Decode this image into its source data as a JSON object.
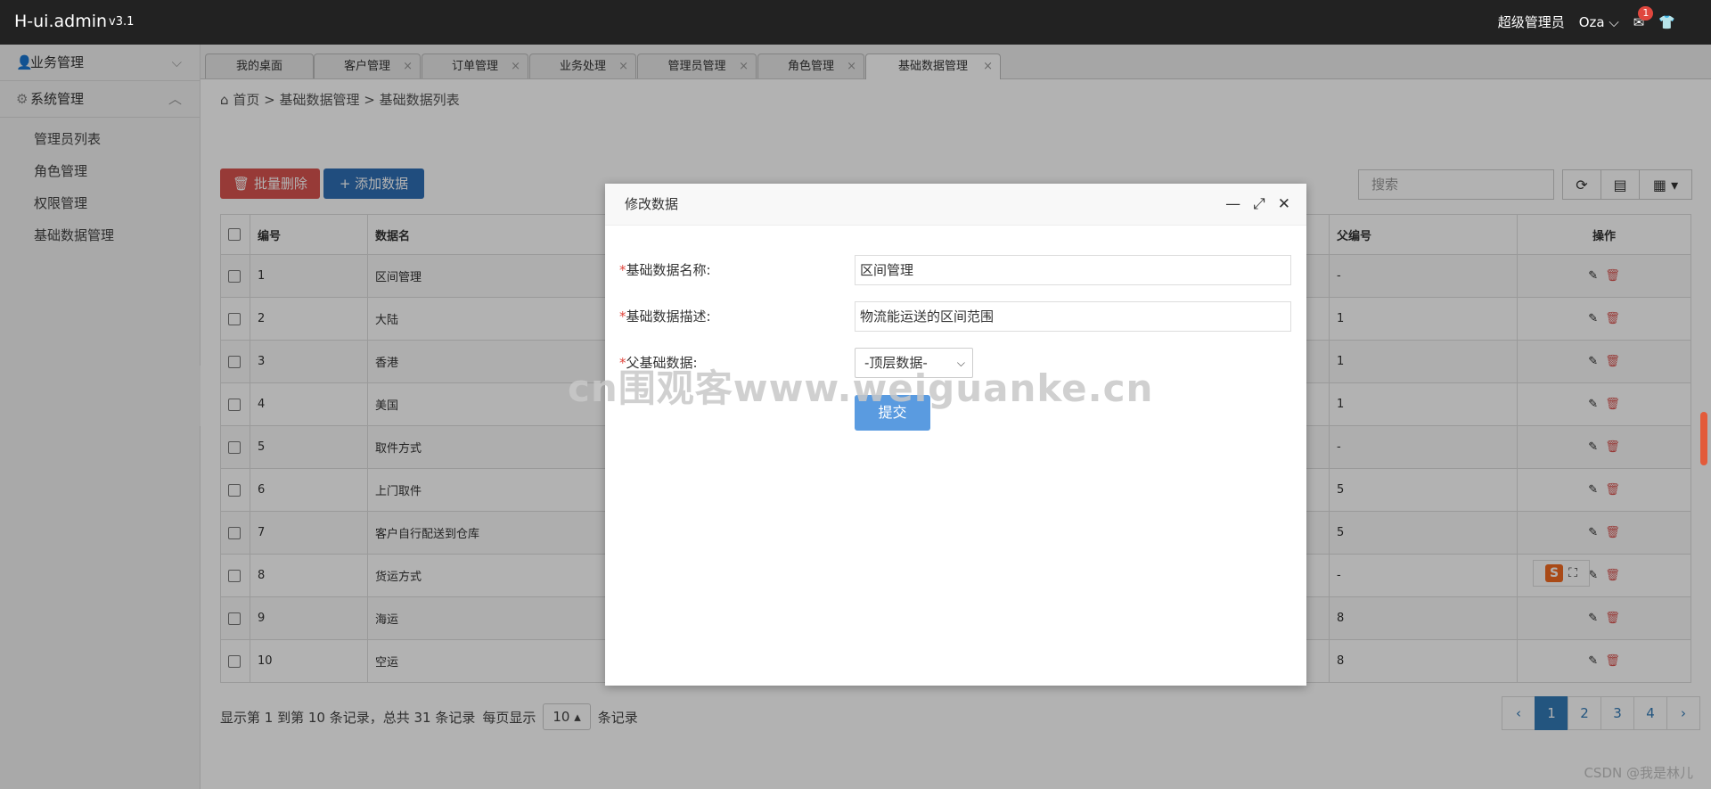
{
  "header": {
    "brand": "H-ui.admin",
    "version": "v3.1",
    "role": "超级管理员",
    "user": "Oza",
    "mail_badge": "1"
  },
  "sidebar": {
    "groups": [
      {
        "label": "业务管理",
        "expanded": false
      },
      {
        "label": "系统管理",
        "expanded": true
      }
    ],
    "items": [
      "管理员列表",
      "角色管理",
      "权限管理",
      "基础数据管理"
    ]
  },
  "tabs": [
    "我的桌面",
    "客户管理",
    "订单管理",
    "业务处理",
    "管理员管理",
    "角色管理",
    "基础数据管理"
  ],
  "breadcrumb": {
    "home": "首页",
    "level1": "基础数据管理",
    "level2": "基础数据列表",
    "sep": ">"
  },
  "toolbar": {
    "batch_delete": "批量删除",
    "add_data": "添加数据",
    "search_placeholder": "搜索"
  },
  "table": {
    "columns": {
      "id": "编号",
      "name": "数据名",
      "parent": "父编号",
      "ops": "操作"
    },
    "rows": [
      {
        "id": "1",
        "name": "区间管理",
        "parent": "-"
      },
      {
        "id": "2",
        "name": "大陆",
        "parent": "1"
      },
      {
        "id": "3",
        "name": "香港",
        "parent": "1"
      },
      {
        "id": "4",
        "name": "美国",
        "parent": "1"
      },
      {
        "id": "5",
        "name": "取件方式",
        "parent": "-"
      },
      {
        "id": "6",
        "name": "上门取件",
        "parent": "5"
      },
      {
        "id": "7",
        "name": "客户自行配送到仓库",
        "parent": "5"
      },
      {
        "id": "8",
        "name": "货运方式",
        "parent": "-"
      },
      {
        "id": "9",
        "name": "海运",
        "parent": "8"
      },
      {
        "id": "10",
        "name": "空运",
        "parent": "8"
      }
    ]
  },
  "pagination": {
    "info": "显示第 1 到第 10 条记录，总共 31 条记录",
    "per_page_prefix": "每页显示",
    "per_page": "10",
    "per_page_suffix": "条记录",
    "prev": "‹",
    "next": "›",
    "pages": [
      "1",
      "2",
      "3",
      "4"
    ],
    "current": "1"
  },
  "modal": {
    "title": "修改数据",
    "name_label": "基础数据名称:",
    "name_value": "区间管理",
    "desc_label": "基础数据描述:",
    "desc_value": "物流能运送的区间范围",
    "parent_label": "父基础数据:",
    "parent_value": "-顶层数据-",
    "submit": "提交",
    "required_mark": "*"
  },
  "watermark": "cn围观客www.weiguanke.cn",
  "credit": "CSDN @我是林儿",
  "colors": {
    "danger": "#d9534f",
    "primary": "#2f6fb5",
    "submit": "#5a9be0",
    "topbar": "#222222"
  }
}
